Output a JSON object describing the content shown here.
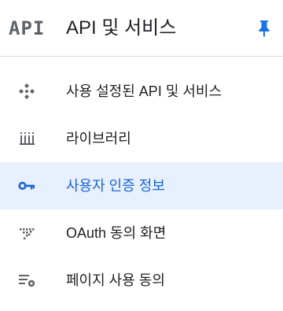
{
  "header": {
    "logo_text": "API",
    "title": "API 및 서비스",
    "pin_icon": "pin-icon"
  },
  "colors": {
    "accent": "#1a73e8",
    "active_bg": "#e8f0fe",
    "active_text": "#1967d2",
    "icon_gray": "#5f6368",
    "text": "#202124"
  },
  "nav": {
    "items": [
      {
        "label": "사용 설정된 API 및 서비스",
        "icon": "api-diamond-icon",
        "active": false
      },
      {
        "label": "라이브러리",
        "icon": "library-icon",
        "active": false
      },
      {
        "label": "사용자 인증 정보",
        "icon": "key-icon",
        "active": true
      },
      {
        "label": "OAuth 동의 화면",
        "icon": "oauth-dots-icon",
        "active": false
      },
      {
        "label": "페이지 사용 동의",
        "icon": "settings-list-icon",
        "active": false
      }
    ]
  }
}
